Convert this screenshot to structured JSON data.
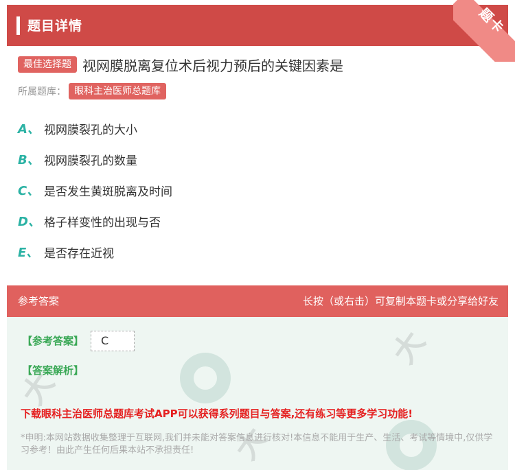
{
  "header": {
    "title": "题目详情"
  },
  "corner": {
    "label": "题卡"
  },
  "question": {
    "badge": "最佳选择题",
    "text": "视网膜脱离复位术后视力预后的关键因素是"
  },
  "category": {
    "label": "所属题库：",
    "value": "眼科主治医师总题库"
  },
  "options": [
    {
      "letter": "A、",
      "text": "视网膜裂孔的大小"
    },
    {
      "letter": "B、",
      "text": "视网膜裂孔的数量"
    },
    {
      "letter": "C、",
      "text": "是否发生黄斑脱离及时间"
    },
    {
      "letter": "D、",
      "text": "格子样变性的出现与否"
    },
    {
      "letter": "E、",
      "text": "是否存在近视"
    }
  ],
  "answer_section": {
    "title": "参考答案",
    "hint": "长按（或右击）可复制本题卡或分享给好友",
    "answer_label": "【参考答案】",
    "answer_value": "C",
    "explain_label": "【答案解析】",
    "promo": "下载眼科主治医师总题库考试APP可以获得系列题目与答案,还有练习等更多学习功能!",
    "disclaimer": "*申明:本网站数据收集整理于互联网,我们并未能对答案信息进行核对!本信息不能用于生产、生活、考试等情境中,仅供学习参考！由此产生任何后果本站不承担责任!"
  },
  "colors": {
    "header": "#cf4a47",
    "badge": "#e06360",
    "option_letter": "#2bb2a4",
    "answer_label": "#3aa856",
    "promo": "#e52020"
  }
}
